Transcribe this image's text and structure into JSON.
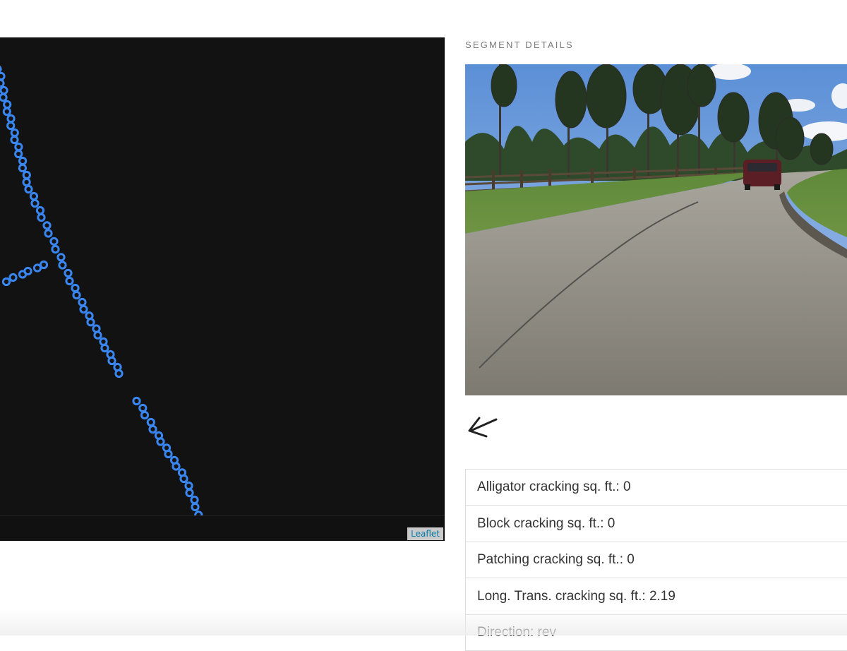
{
  "map": {
    "attribution": "Leaflet",
    "marker_color": "#3a86f0",
    "background": "#121212"
  },
  "details": {
    "section_title": "SEGMENT DETAILS",
    "back_icon": "arrow-down-left-icon",
    "rows": [
      {
        "label": "Alligator cracking sq. ft.: 0"
      },
      {
        "label": "Block cracking sq. ft.: 0"
      },
      {
        "label": "Patching cracking sq. ft.: 0"
      },
      {
        "label": "Long. Trans. cracking sq. ft.: 2.19"
      },
      {
        "label": "Direction: rev"
      }
    ]
  }
}
